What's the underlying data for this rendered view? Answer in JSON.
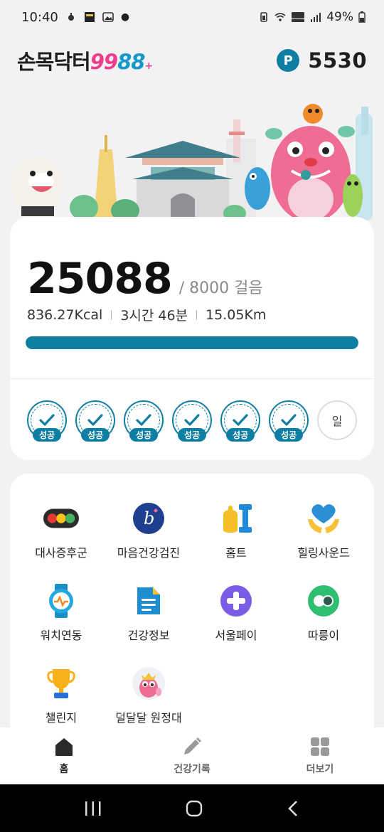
{
  "status_bar": {
    "time": "10:40",
    "battery": "49%"
  },
  "header": {
    "logo_main": "손목닥터",
    "logo_99": "99",
    "logo_88": "88",
    "logo_plus": "+",
    "points_badge": "P",
    "points": "5530"
  },
  "steps": {
    "value": "25088",
    "goal": "/ 8000 걸음",
    "progress": 1.0,
    "calories": "836.27Kcal",
    "duration": "3시간 46분",
    "distance": "15.05Km"
  },
  "week": {
    "days": [
      {
        "badge": "성공",
        "done": true
      },
      {
        "badge": "성공",
        "done": true
      },
      {
        "badge": "성공",
        "done": true
      },
      {
        "badge": "성공",
        "done": true
      },
      {
        "badge": "성공",
        "done": true
      },
      {
        "badge": "성공",
        "done": true
      },
      {
        "badge": "일",
        "done": false
      }
    ]
  },
  "menu": {
    "items": [
      {
        "label": "대사증후군",
        "icon": "traffic-light-icon"
      },
      {
        "label": "마음건강검진",
        "icon": "mind-b-icon"
      },
      {
        "label": "홈트",
        "icon": "dumbbell-icon"
      },
      {
        "label": "힐링사운드",
        "icon": "heart-hands-icon"
      },
      {
        "label": "워치연동",
        "icon": "watch-icon"
      },
      {
        "label": "건강정보",
        "icon": "document-icon"
      },
      {
        "label": "서울페이",
        "icon": "plus-circle-icon"
      },
      {
        "label": "따릉이",
        "icon": "bike-icon"
      },
      {
        "label": "챌린지",
        "icon": "trophy-icon"
      },
      {
        "label": "덜달달 원정대",
        "icon": "character-avatar-icon"
      }
    ]
  },
  "bottom_nav": {
    "home": "홈",
    "record": "건강기록",
    "more": "더보기"
  },
  "colors": {
    "accent": "#0e7ea3",
    "logo_pink": "#f03c8c",
    "logo_blue": "#1799c8"
  }
}
